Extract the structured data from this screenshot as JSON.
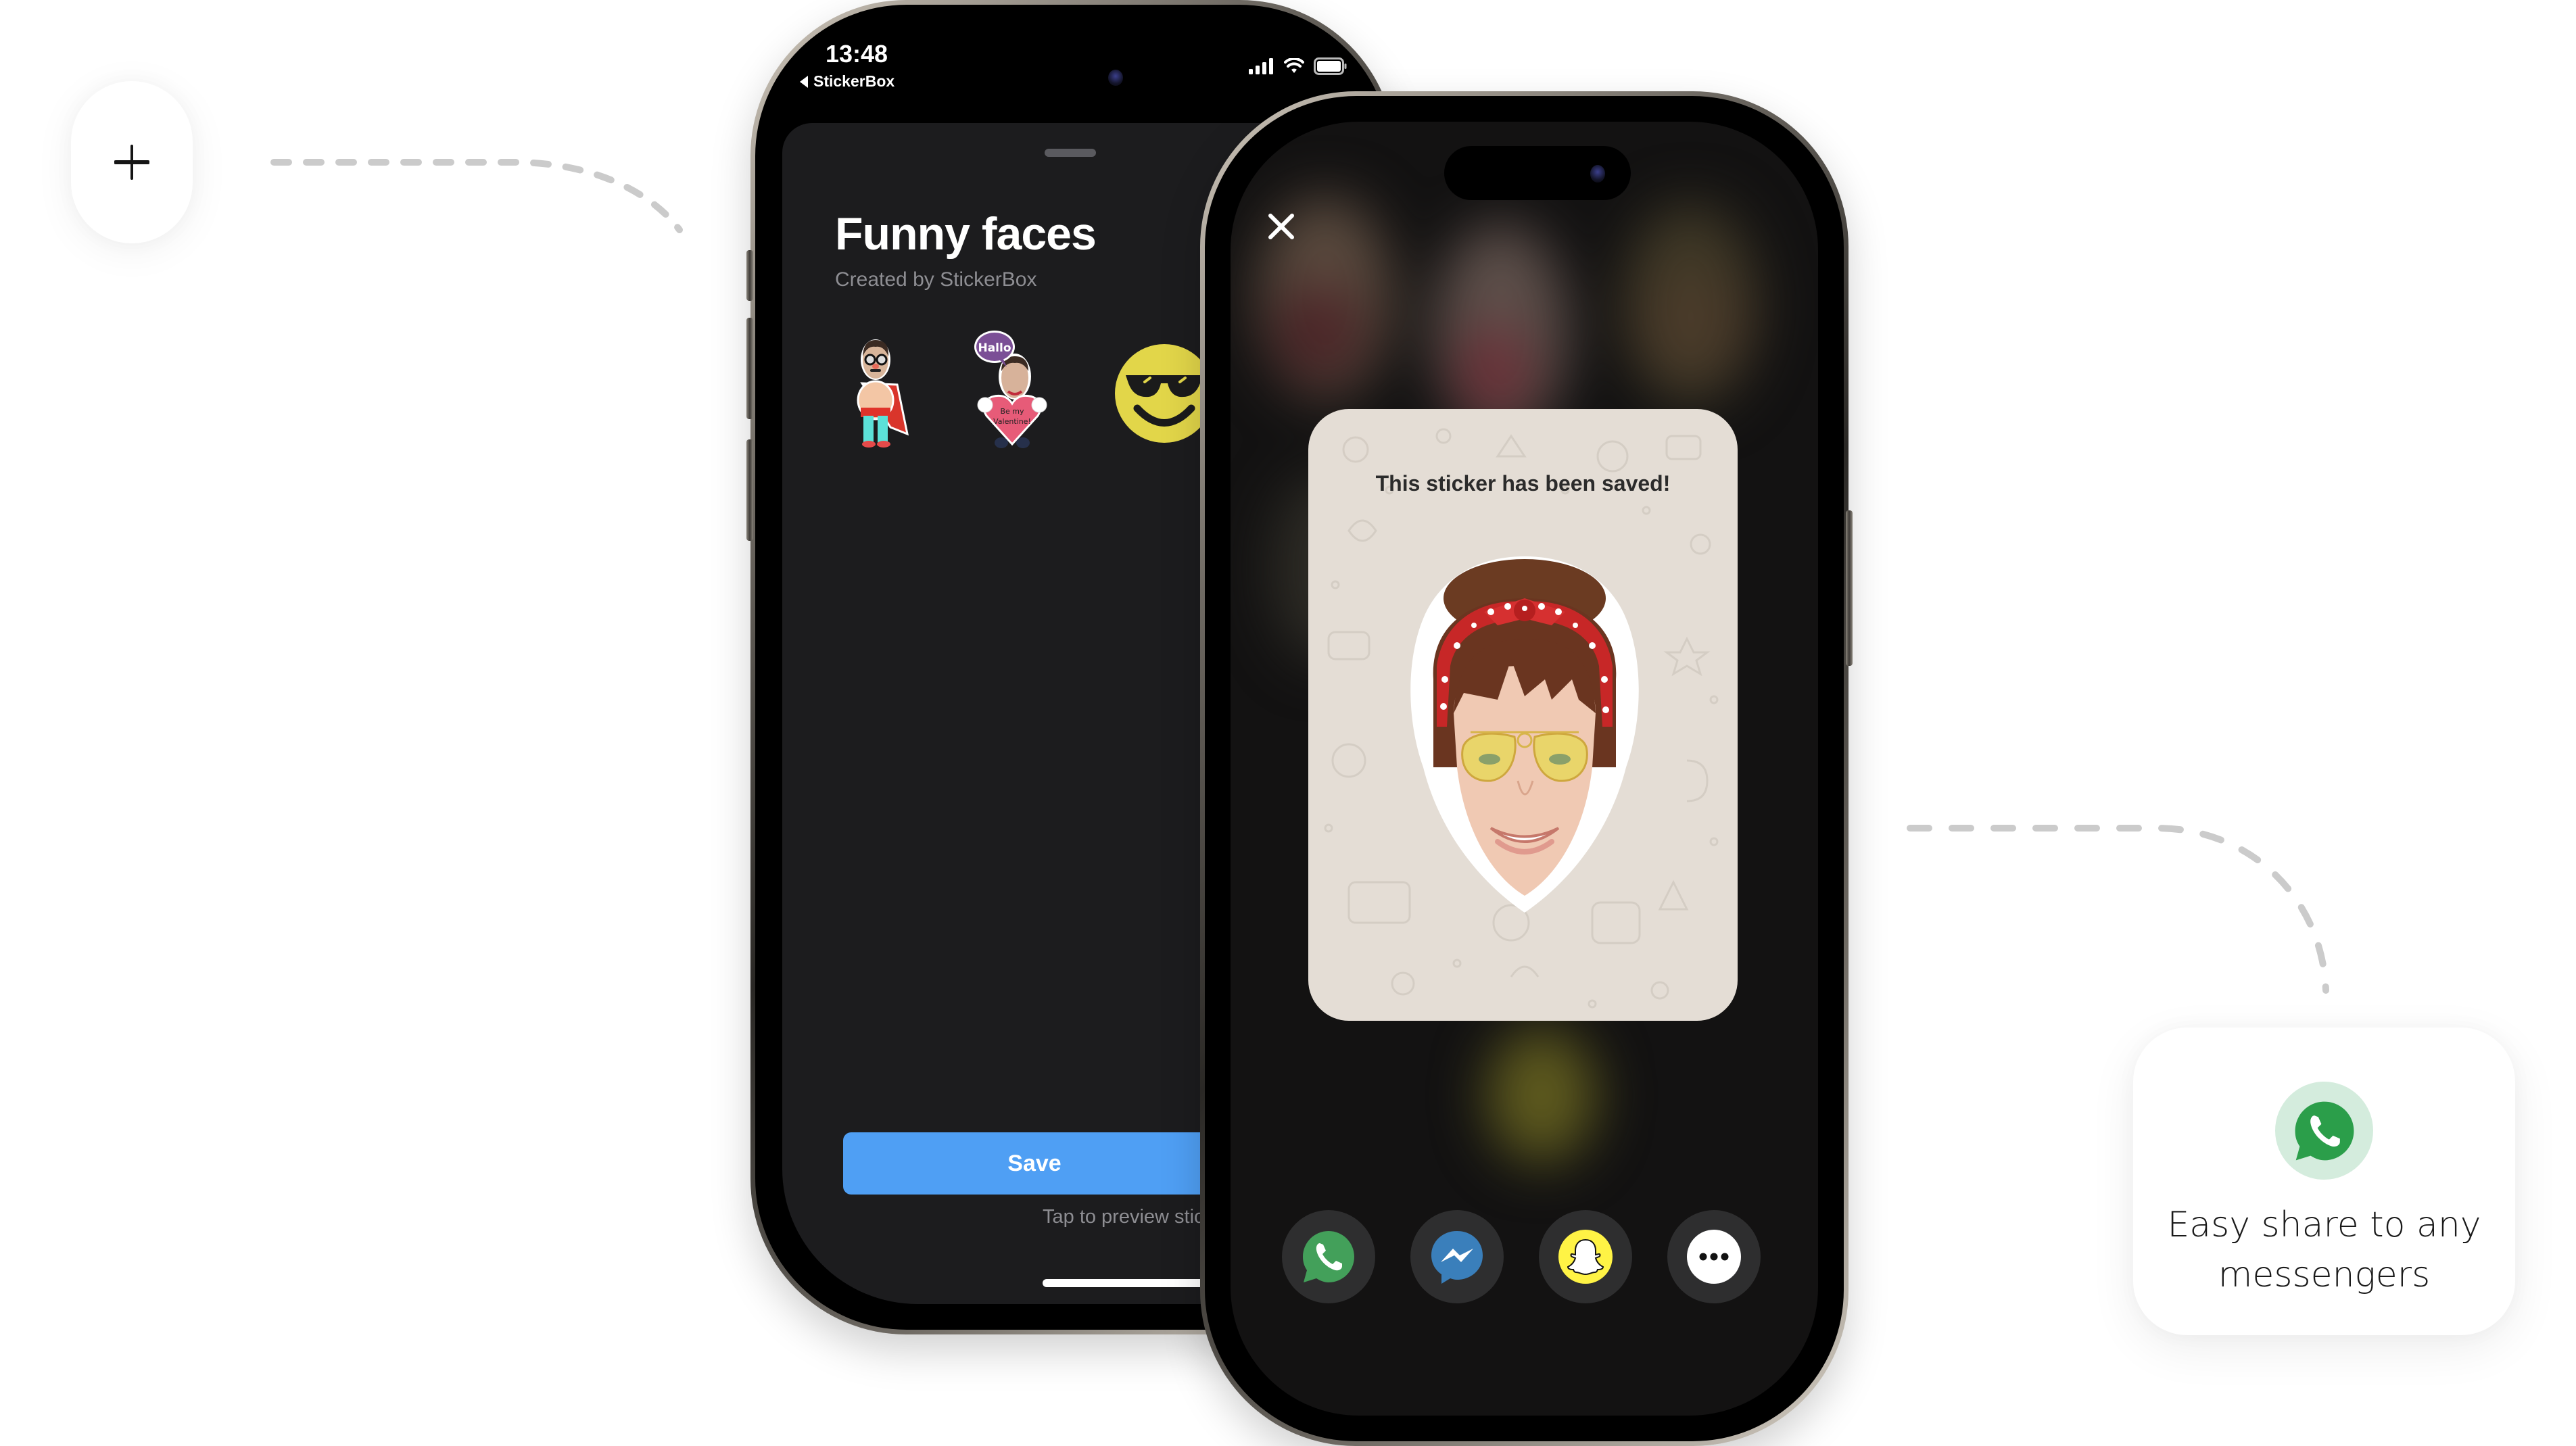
{
  "back_phone": {
    "status_bar": {
      "time": "13:48",
      "back_app": "StickerBox",
      "icons": [
        "cellular-signal-icon",
        "wifi-icon",
        "battery-icon"
      ]
    },
    "sheet": {
      "title": "Funny faces",
      "subtitle": "Created by StickerBox",
      "stickers": [
        {
          "name": "superhero-man-sticker"
        },
        {
          "name": "valentine-man-sticker",
          "bubble_text": "Hallo",
          "heart_text": "Be my Valentine!"
        },
        {
          "name": "cool-smiley-sticker"
        }
      ],
      "save_label": "Save",
      "hint": "Tap to preview sticker"
    }
  },
  "front_phone": {
    "close_icon": "close-icon",
    "saved_card": {
      "title": "This sticker has been saved!",
      "sticker": "girl-with-red-bandana-sticker"
    },
    "share_targets": [
      {
        "name": "whatsapp",
        "icon": "whatsapp-icon",
        "color": "#43a05a"
      },
      {
        "name": "messenger",
        "icon": "messenger-icon",
        "color": "#3a7fbb"
      },
      {
        "name": "snapchat",
        "icon": "snapchat-icon",
        "color": "#fff345"
      },
      {
        "name": "more",
        "icon": "more-dots-icon",
        "color": "#ffffff"
      }
    ]
  },
  "plus_card": {
    "icon": "plus-icon"
  },
  "share_card": {
    "icon": "whatsapp-icon",
    "text": "Easy share to any messengers"
  },
  "colors": {
    "accent_blue": "#4f9ff4",
    "sheet_bg": "#1c1c1e",
    "card_bg": "#e4ddd5",
    "whatsapp_green": "#2b9e4a",
    "whatsapp_halo": "#d4ecdd"
  }
}
